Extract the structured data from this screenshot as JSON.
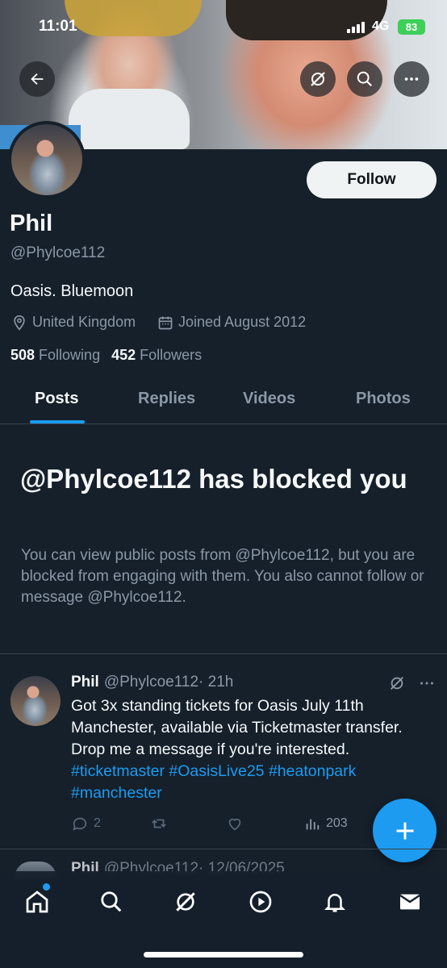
{
  "status_bar": {
    "time": "11:01",
    "network": "4G",
    "battery": "83"
  },
  "profile": {
    "name": "Phil",
    "handle": "@Phylcoe112",
    "bio": "Oasis. Bluemoon",
    "location": "United Kingdom",
    "joined": "Joined August 2012",
    "following_count": "508",
    "following_label": "Following",
    "followers_count": "452",
    "followers_label": "Followers",
    "follow_label": "Follow"
  },
  "tabs": [
    {
      "label": "Posts",
      "active": true
    },
    {
      "label": "Replies",
      "active": false
    },
    {
      "label": "Videos",
      "active": false
    },
    {
      "label": "Photos",
      "active": false
    }
  ],
  "blocked": {
    "title": "@Phylcoe112 has blocked you",
    "description": "You can view public posts from @Phylcoe112, but you are blocked from engaging with them. You also cannot follow or message @Phylcoe112."
  },
  "post": {
    "author": "Phil",
    "handle": "@Phylcoe112",
    "time": "· 21h",
    "text": "Got 3x standing tickets for Oasis July 11th Manchester, available via Ticketmaster transfer. Drop me a message if you're interested.",
    "hashtags": [
      "#ticketmaster",
      "#OasisLive25",
      "#heatonpark",
      "#manchester"
    ],
    "replies": "2",
    "views": "203"
  },
  "next_post": {
    "author": "Phil",
    "handle": "@Phylcoe112",
    "time": "· 12/06/2025"
  },
  "icons": {
    "back": "back-arrow-icon",
    "grok": "grok-icon",
    "search": "search-icon",
    "more": "more-icon",
    "location": "location-pin-icon",
    "calendar": "calendar-icon",
    "compose": "plus-icon",
    "nav": [
      "home-icon",
      "search-icon",
      "grok-icon",
      "play-icon",
      "bell-icon",
      "mail-icon"
    ]
  },
  "colors": {
    "accent": "#1d9bf0",
    "background": "#15202b",
    "secondary_text": "#8b98a5"
  }
}
